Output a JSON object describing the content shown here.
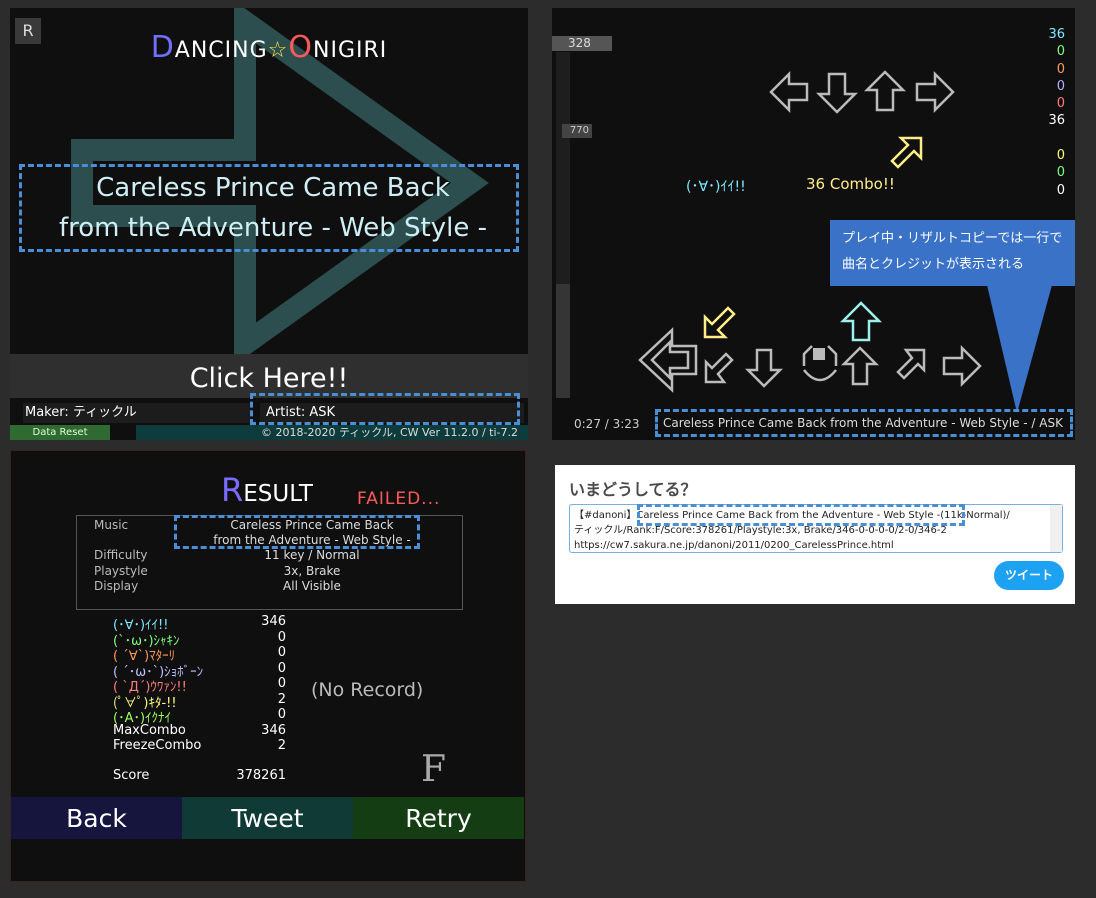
{
  "title_screen": {
    "reset_key": "R",
    "logo": {
      "first_cap": "D",
      "first_rest": "ANCING",
      "star": "☆",
      "second_cap": "O",
      "second_rest": "NIGIRI"
    },
    "song_line1": "Careless Prince Came Back",
    "song_line2": "from the Adventure - Web Style -",
    "start_label": "Click Here!!",
    "maker": "Maker: ティックル",
    "artist": "Artist: ASK",
    "data_reset": "Data Reset",
    "copyright": "© 2018-2020 ティックル, CW Ver 11.2.0 / ti-7.2"
  },
  "play_screen": {
    "score": "328",
    "life_marker": "770",
    "judge_counts": [
      {
        "value": "36",
        "color": "#7de8ff"
      },
      {
        "value": "0",
        "color": "#7dff7d"
      },
      {
        "value": "0",
        "color": "#ff9a5a"
      },
      {
        "value": "0",
        "color": "#b0b0ff"
      },
      {
        "value": "0",
        "color": "#ff7d7d"
      },
      {
        "value": "36",
        "color": "#ffffff"
      },
      {
        "value": "",
        "color": "#ffffff"
      },
      {
        "value": "0",
        "color": "#ffff7d"
      },
      {
        "value": "0",
        "color": "#7dff7d"
      },
      {
        "value": "0",
        "color": "#ffffff"
      }
    ],
    "judge_text": "(･∀･)ｲｲ!!",
    "combo_text": "36 Combo!!",
    "callout_line1": "プレイ中・リザルトコピーでは一行で",
    "callout_line2": "曲名とクレジットが表示される",
    "time": "0:27  / 3:23",
    "song_info": "Careless Prince Came Back from the Adventure - Web Style - / ASK"
  },
  "result_screen": {
    "title_cap": "R",
    "title_rest": "ESULT",
    "failed_text": "FAILED...",
    "music_label": "Music",
    "music_line1": "Careless Prince Came Back",
    "music_line2": "from the Adventure - Web Style -",
    "difficulty_label": "Difficulty",
    "difficulty": "11 key / Normal",
    "playstyle_label": "Playstyle",
    "playstyle": "3x, Brake",
    "display_label": "Display",
    "display": "All Visible",
    "judgments": [
      {
        "label": "(･∀･)ｲｲ!!",
        "value": "346",
        "color": "#7de8ff"
      },
      {
        "label": "(`･ω･)ｼｬｷﾝ",
        "value": "0",
        "color": "#7dff7d"
      },
      {
        "label": "( ´∀`)ﾏﾀｰﾘ",
        "value": "0",
        "color": "#ff9a5a"
      },
      {
        "label": "( ´･ω･`)ｼｮﾎﾞｰﾝ",
        "value": "0",
        "color": "#c0c0ff"
      },
      {
        "label": "( `Д´)ｳﾜｧﾝ!!",
        "value": "0",
        "color": "#ff7d7d"
      },
      {
        "label": "(ﾟ∀ﾟ)ｷﾀ-!!",
        "value": "2",
        "color": "#ffff7d"
      },
      {
        "label": "(･A･)ｲｸﾅｲ",
        "value": "0",
        "color": "#9dff5a"
      },
      {
        "label": "MaxCombo",
        "value": "346",
        "color": "#ffffff"
      },
      {
        "label": "FreezeCombo",
        "value": "2",
        "color": "#ffffff"
      }
    ],
    "score_label": "Score",
    "score": "378261",
    "no_record": "(No Record)",
    "rank": "F",
    "back_label": "Back",
    "tweet_label": "Tweet",
    "retry_label": "Retry"
  },
  "tweet_panel": {
    "heading": "いまどうしてる？",
    "text_line1": "【#danoni】Careless Prince Came Back from the Adventure - Web Style -(11k-Normal)/",
    "text_line2": "ティックル/Rank:F/Score:378261/Playstyle:3x, Brake/346-0-0-0-0/2-0/346-2",
    "text_line3": "https://cw7.sakura.ne.jp/danoni/2011/0200_CarelessPrince.html",
    "button": "ツイート"
  },
  "colors": {
    "accent_dash": "#4a8fd6",
    "back_button": "#15153d",
    "tweet_button": "#0f3a36",
    "retry_button": "#143d14"
  }
}
